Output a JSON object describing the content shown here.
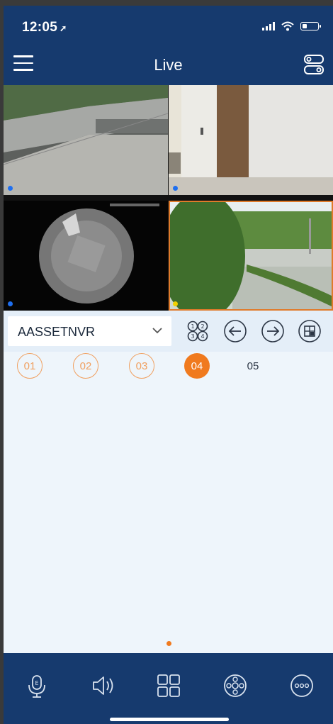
{
  "status_bar": {
    "time": "12:05",
    "location_glyph": "➚"
  },
  "header": {
    "title": "Live",
    "menu_icon": "hamburger-icon",
    "right_icon": "device-settings-icon"
  },
  "cameras": [
    {
      "id": "cam1",
      "indicator_color": "#1e6ff0",
      "selected": false
    },
    {
      "id": "cam2",
      "indicator_color": "#1e6ff0",
      "selected": false
    },
    {
      "id": "cam3",
      "indicator_color": "#1e6ff0",
      "selected": false
    },
    {
      "id": "cam4",
      "indicator_color": "#f0d000",
      "selected": true
    }
  ],
  "device": {
    "name": "AASSETNVR"
  },
  "toolbar": [
    "split-view-icon",
    "previous-icon",
    "next-icon",
    "layout-icon"
  ],
  "channels": [
    {
      "label": "01",
      "state": "outline"
    },
    {
      "label": "02",
      "state": "outline"
    },
    {
      "label": "03",
      "state": "outline"
    },
    {
      "label": "04",
      "state": "active"
    },
    {
      "label": "05",
      "state": "plain"
    }
  ],
  "bottom_bar": [
    "talk-icon",
    "audio-icon",
    "grid-icon",
    "ptz-icon",
    "more-icon"
  ],
  "colors": {
    "header": "#163a6e",
    "accent": "#f07a1e",
    "background": "#eef5fb"
  }
}
